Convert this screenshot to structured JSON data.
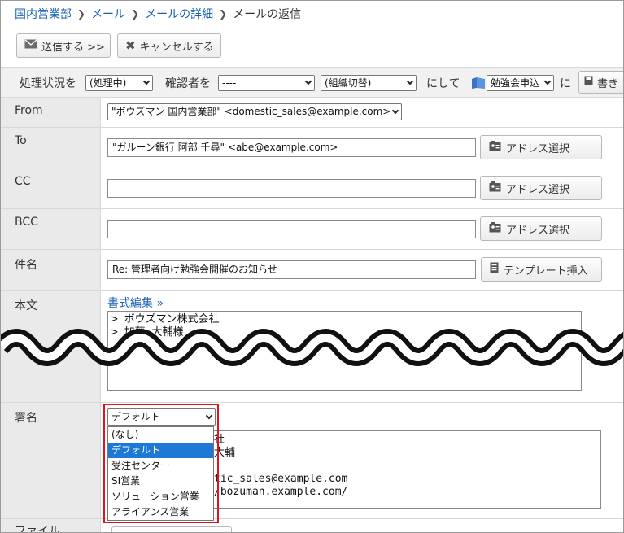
{
  "breadcrumb": {
    "items": [
      "国内営業部",
      "メール",
      "メールの詳細"
    ],
    "current": "メールの返信"
  },
  "actions": {
    "send_label": "送信する >>",
    "cancel_label": "キャンセルする"
  },
  "toolbar": {
    "status_label": "処理状況を",
    "status_value": "(処理中)",
    "confirmer_label": "確認者を",
    "confirmer_value": "----",
    "org_value": "(組織切替)",
    "then_label": "にして",
    "folder_value": "勉強会申込",
    "ni_label": "に",
    "draft_label": "書き"
  },
  "form": {
    "from_label": "From",
    "from_value": "\"ボウズマン 国内営業部\" <domestic_sales@example.com>",
    "to_label": "To",
    "to_value": "\"ガルーン銀行 阿部 千尋\" <abe@example.com>",
    "cc_label": "CC",
    "cc_value": "",
    "bcc_label": "BCC",
    "bcc_value": "",
    "address_button": "アドレス選択",
    "subject_label": "件名",
    "subject_value": "Re: 管理者向け勉強会開催のお知らせ",
    "template_button": "テンプレート挿入",
    "body_label": "本文",
    "format_link": "書式編集 »",
    "body_line1": "> ボウズマン株式会社",
    "body_line2": "> 加藤 大輔様",
    "signature_label": "署名",
    "signature_value": "デフォルト",
    "signature_options": [
      "(なし)",
      "デフォルト",
      "受注センター",
      "SI営業",
      "ソリューション営業",
      "アライアンス営業"
    ],
    "sig_line1": "社",
    "sig_line2": "大輔",
    "sig_line3": "tic_sales@example.com",
    "sig_line4": "/bozuman.example.com/",
    "file_label": "ファイル"
  },
  "colors": {
    "link": "#1a62b5",
    "highlight": "#e0141e",
    "selected_option": "#1e79d6"
  }
}
